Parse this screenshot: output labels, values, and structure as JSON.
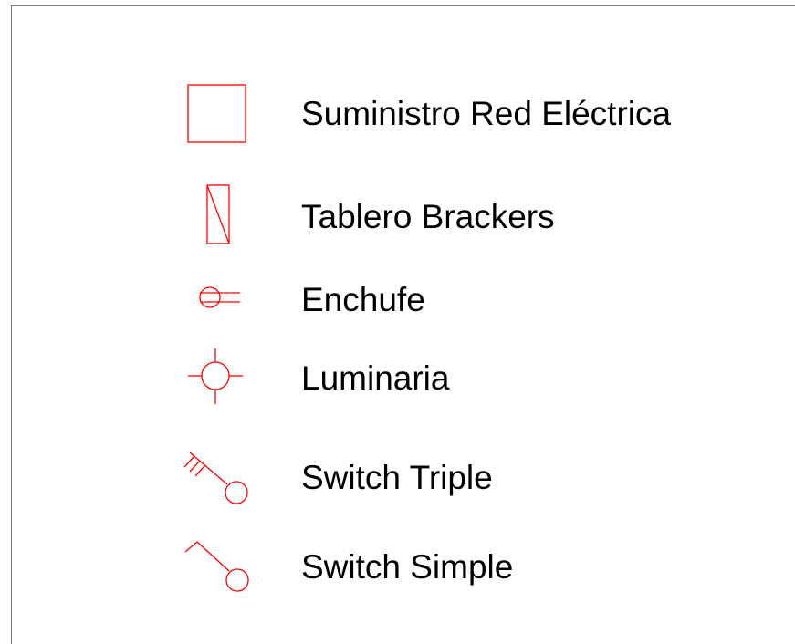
{
  "legend": {
    "stroke_color": "#ff0000",
    "items": [
      {
        "icon": "square-icon",
        "label": "Suministro Red Eléctrica"
      },
      {
        "icon": "breaker-panel-icon",
        "label": "Tablero Brackers"
      },
      {
        "icon": "outlet-icon",
        "label": "Enchufe"
      },
      {
        "icon": "light-fixture-icon",
        "label": "Luminaria"
      },
      {
        "icon": "triple-switch-icon",
        "label": "Switch Triple"
      },
      {
        "icon": "simple-switch-icon",
        "label": "Switch Simple"
      }
    ]
  }
}
